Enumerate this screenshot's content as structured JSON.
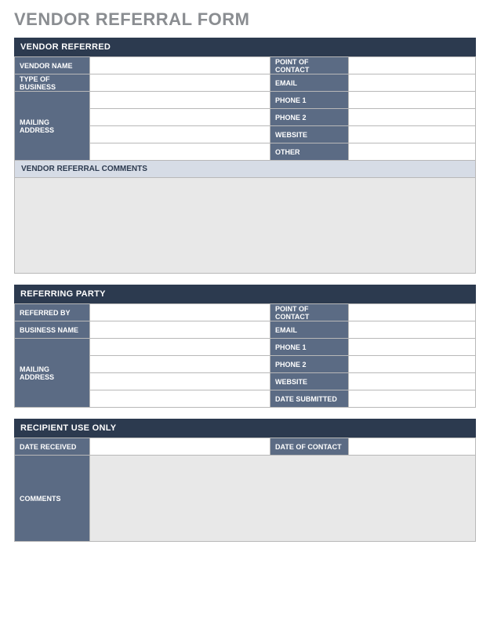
{
  "title": "VENDOR REFERRAL FORM",
  "section1": {
    "header": "VENDOR REFERRED",
    "vendor_name_label": "VENDOR NAME",
    "vendor_name": "",
    "point_of_contact_label": "POINT OF CONTACT",
    "point_of_contact": "",
    "type_of_business_label": "TYPE OF BUSINESS",
    "type_of_business": "",
    "email_label": "EMAIL",
    "email": "",
    "mailing_address_label": "MAILING ADDRESS",
    "mail1": "",
    "mail2": "",
    "mail3": "",
    "mail4": "",
    "phone1_label": "PHONE 1",
    "phone1": "",
    "phone2_label": "PHONE 2",
    "phone2": "",
    "website_label": "WEBSITE",
    "website": "",
    "other_label": "OTHER",
    "other": "",
    "comments_header": "VENDOR REFERRAL COMMENTS",
    "comments": ""
  },
  "section2": {
    "header": "REFERRING PARTY",
    "referred_by_label": "REFERRED BY",
    "referred_by": "",
    "point_of_contact_label": "POINT OF CONTACT",
    "point_of_contact": "",
    "business_name_label": "BUSINESS NAME",
    "business_name": "",
    "email_label": "EMAIL",
    "email": "",
    "mailing_address_label": "MAILING ADDRESS",
    "mail1": "",
    "mail2": "",
    "mail3": "",
    "mail4": "",
    "phone1_label": "PHONE 1",
    "phone1": "",
    "phone2_label": "PHONE 2",
    "phone2": "",
    "website_label": "WEBSITE",
    "website": "",
    "date_submitted_label": "DATE SUBMITTED",
    "date_submitted": ""
  },
  "section3": {
    "header": "RECIPIENT USE ONLY",
    "date_received_label": "DATE RECEIVED",
    "date_received": "",
    "date_of_contact_label": "DATE OF CONTACT",
    "date_of_contact": "",
    "comments_label": "COMMENTS",
    "comments": ""
  }
}
